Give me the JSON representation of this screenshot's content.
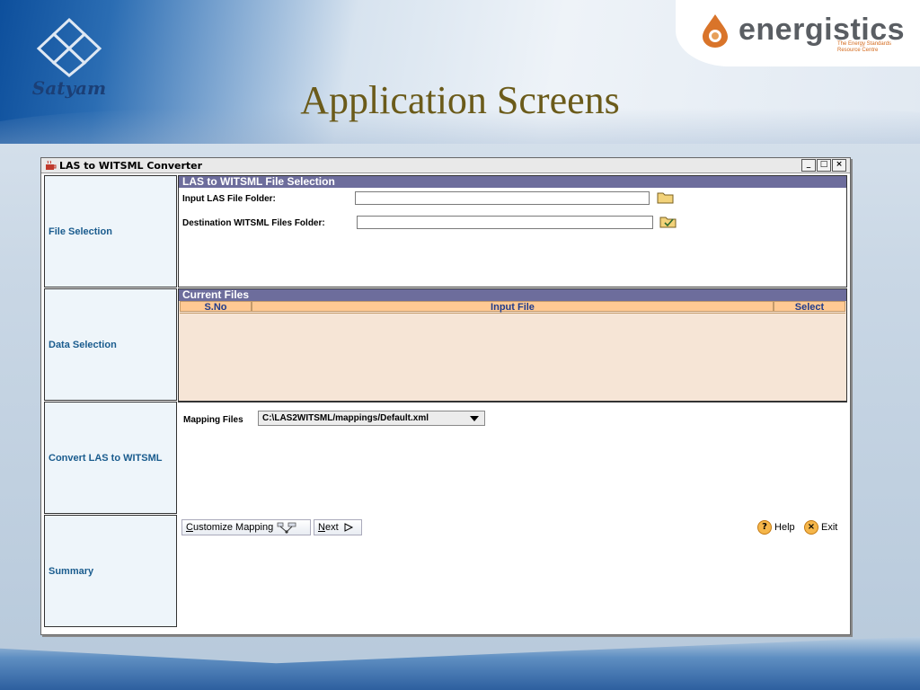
{
  "slide": {
    "title": "Application Screens",
    "left_logo_text": "Satyam",
    "right_logo": {
      "brand": "energistics",
      "tagline_1": "The Energy Standards",
      "tagline_2": "Resource Centre"
    }
  },
  "window": {
    "title": "LAS to WITSML Converter",
    "controls": {
      "minimize": "_",
      "maximize": "□",
      "close": "×"
    }
  },
  "nav": {
    "items": [
      {
        "label": "File Selection"
      },
      {
        "label": "Data Selection"
      },
      {
        "label": "Convert LAS to WITSML"
      },
      {
        "label": "Summary"
      }
    ]
  },
  "file_selection": {
    "header": "LAS to WITSML File Selection",
    "input_label": "Input LAS File Folder:",
    "input_value": "",
    "dest_label": "Destination WITSML Files Folder:",
    "dest_value": ""
  },
  "current_files": {
    "header": "Current Files",
    "columns": [
      "S.No",
      "Input File",
      "Select"
    ]
  },
  "convert": {
    "mapping_label": "Mapping Files",
    "mapping_selected": "C:\\LAS2WITSML/mappings/Default.xml"
  },
  "actions": {
    "customize_mapping": {
      "mnemonic": "C",
      "rest": "ustomize Mapping"
    },
    "next": {
      "mnemonic": "N",
      "rest": "ext"
    },
    "help": {
      "mnemonic": "H",
      "rest": "elp"
    },
    "exit": {
      "first": "E",
      "mnemonic": "x",
      "rest": "it"
    }
  },
  "colors": {
    "panel_header": "#6d6d9c",
    "table_header": "#ffc993",
    "table_body": "#f6e5d6",
    "nav_text": "#1a5c8e",
    "title_color": "#6b5b1a"
  }
}
